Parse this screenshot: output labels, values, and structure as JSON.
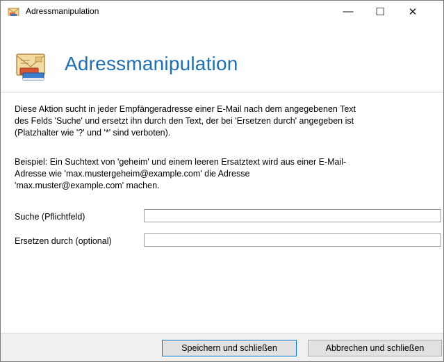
{
  "window": {
    "title": "Adressmanipulation",
    "controls": {
      "minimize": "—",
      "maximize": "☐",
      "close": "✕"
    }
  },
  "header": {
    "title": "Adressmanipulation",
    "icon": "mail-envelope-icon"
  },
  "description": {
    "line1": "Diese Aktion sucht in jeder Empfängeradresse einer E-Mail nach dem angegebenen Text",
    "line2": "des Felds 'Suche' und ersetzt ihn durch den Text, der bei 'Ersetzen durch' angegeben ist",
    "line3": "(Platzhalter wie '?' und '*' sind verboten)."
  },
  "example": {
    "line1": "Beispiel: Ein Suchtext von 'geheim' und einem leeren Ersatztext wird aus einer E-Mail-",
    "line2": "Adresse wie 'max.mustergeheim@example.com' die Adresse",
    "line3": "'max.muster@example.com' machen."
  },
  "form": {
    "search_label": "Suche (Pflichtfeld)",
    "search_value": "",
    "replace_label": "Ersetzen durch (optional)",
    "replace_value": ""
  },
  "footer": {
    "save_label": "Speichern und schließen",
    "cancel_label": "Abbrechen und schließen"
  },
  "colors": {
    "accent": "#1f6fb6",
    "footer_bg": "#f0f0f0",
    "button_bg": "#e1e1e1",
    "focus_border": "#0078d7"
  }
}
